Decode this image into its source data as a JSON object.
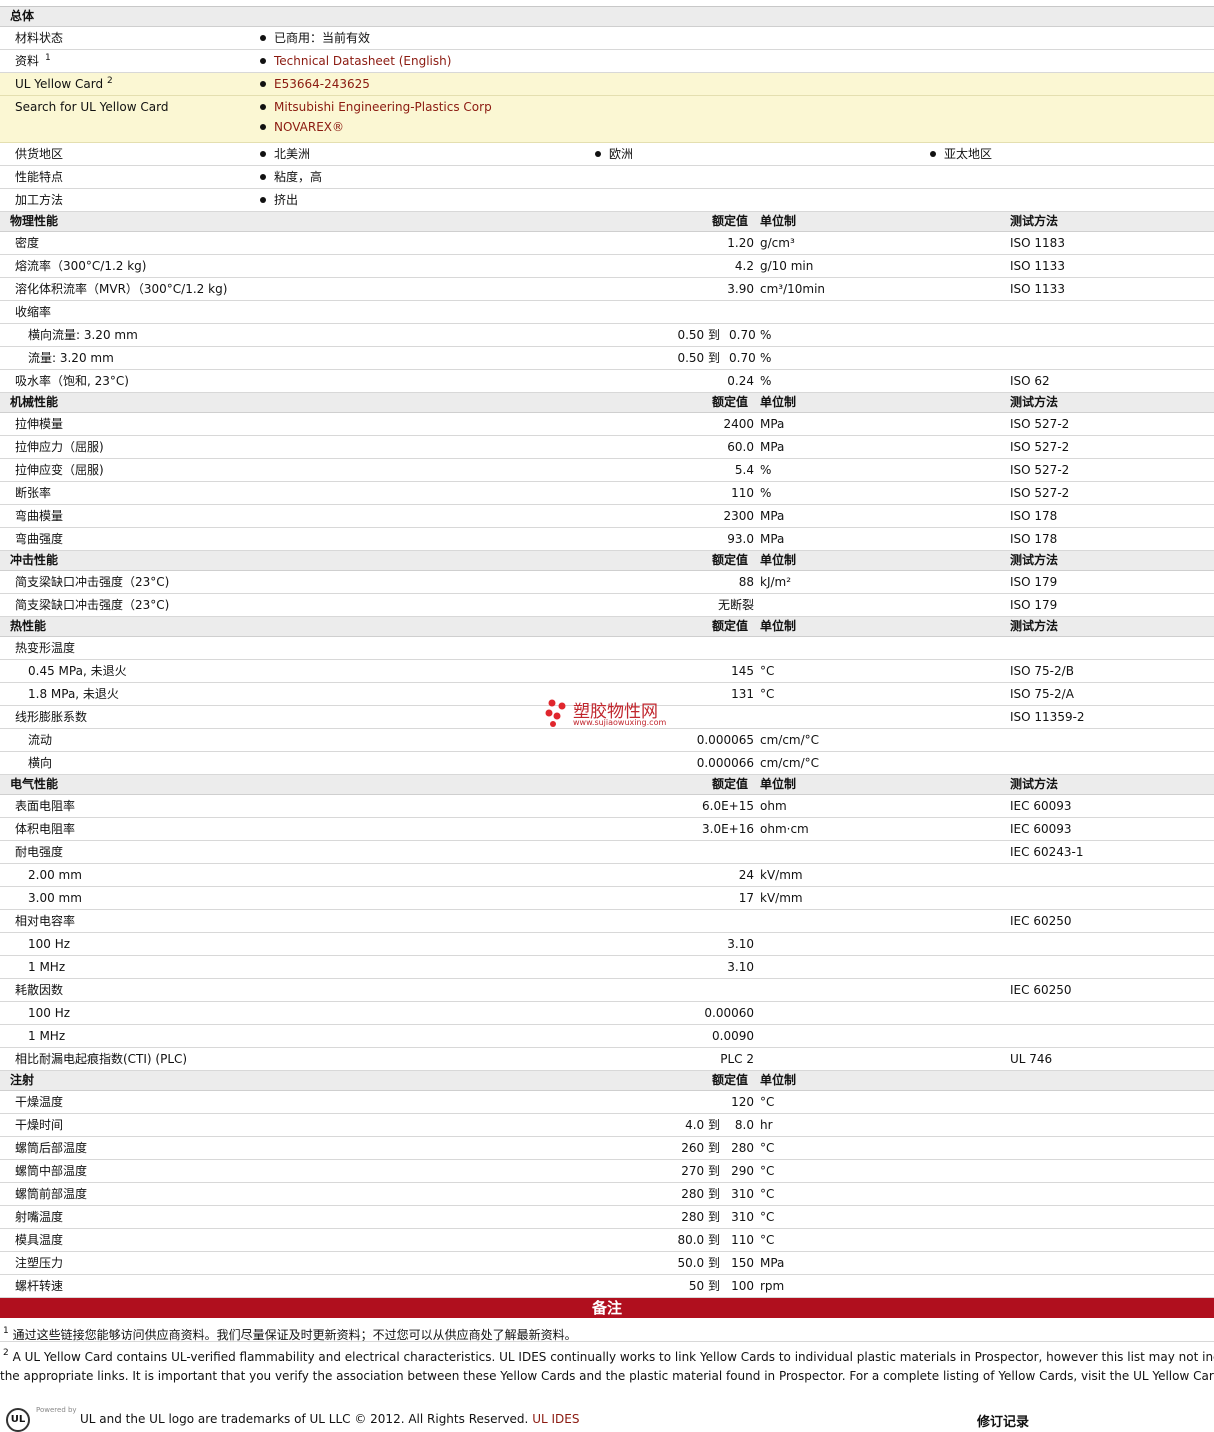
{
  "general": {
    "title": "总体",
    "rows": [
      {
        "label": "材料状态",
        "items": [
          "已商用：当前有效"
        ]
      },
      {
        "label": "资料",
        "sup": "1",
        "items": [
          "Technical Datasheet (English)"
        ],
        "link": true
      },
      {
        "label": "UL Yellow Card",
        "sup": "2",
        "items": [
          "E53664-243625"
        ],
        "link": true,
        "yellow": true
      },
      {
        "label": "Search for UL Yellow Card",
        "items": [
          "Mitsubishi Engineering-Plastics Corp",
          "NOVAREX®"
        ],
        "link": true,
        "yellow": true
      },
      {
        "label": "供货地区",
        "items": [
          "北美洲",
          "欧洲",
          "亚太地区"
        ],
        "spread": true
      },
      {
        "label": "性能特点",
        "items": [
          "粘度，高"
        ]
      },
      {
        "label": "加工方法",
        "items": [
          "挤出"
        ]
      }
    ]
  },
  "sections": [
    {
      "title": "物理性能",
      "h_value": "额定值",
      "h_unit": "单位制",
      "h_method": "测试方法",
      "rows": [
        {
          "label": "密度",
          "v1": "1.20",
          "unit": "g/cm³",
          "method": "ISO 1183"
        },
        {
          "label": "熔流率（300°C/1.2 kg)",
          "v1": "4.2",
          "unit": "g/10 min",
          "method": "ISO 1133"
        },
        {
          "label": "溶化体积流率（MVR）（300°C/1.2 kg)",
          "v1": "3.90",
          "unit": "cm³/10min",
          "method": "ISO 1133"
        },
        {
          "label": "收缩率"
        },
        {
          "label": "横向流量: 3.20 mm",
          "sub": true,
          "v1": "0.50 到",
          "v2": "0.70",
          "unit": "%"
        },
        {
          "label": "流量: 3.20 mm",
          "sub": true,
          "v1": "0.50 到",
          "v2": "0.70",
          "unit": "%"
        },
        {
          "label": "吸水率（饱和, 23°C)",
          "v1": "0.24",
          "unit": "%",
          "method": "ISO 62"
        }
      ]
    },
    {
      "title": "机械性能",
      "h_value": "额定值",
      "h_unit": "单位制",
      "h_method": "测试方法",
      "rows": [
        {
          "label": "拉伸模量",
          "v1": "2400",
          "unit": "MPa",
          "method": "ISO 527-2"
        },
        {
          "label": "拉伸应力（屈服)",
          "v1": "60.0",
          "unit": "MPa",
          "method": "ISO 527-2"
        },
        {
          "label": "拉伸应变（屈服)",
          "v1": "5.4",
          "unit": "%",
          "method": "ISO 527-2"
        },
        {
          "label": "断张率",
          "v1": "110",
          "unit": "%",
          "method": "ISO 527-2"
        },
        {
          "label": "弯曲模量",
          "v1": "2300",
          "unit": "MPa",
          "method": "ISO 178"
        },
        {
          "label": "弯曲强度",
          "v1": "93.0",
          "unit": "MPa",
          "method": "ISO 178"
        }
      ]
    },
    {
      "title": "冲击性能",
      "h_value": "额定值",
      "h_unit": "单位制",
      "h_method": "测试方法",
      "rows": [
        {
          "label": "简支梁缺口冲击强度（23°C)",
          "v1": "88",
          "unit": "kJ/m²",
          "method": "ISO 179"
        },
        {
          "label": "简支梁缺口冲击强度（23°C)",
          "v1": "无断裂",
          "method": "ISO 179"
        }
      ]
    },
    {
      "title": "热性能",
      "h_value": "额定值",
      "h_unit": "单位制",
      "h_method": "测试方法",
      "rows": [
        {
          "label": "热变形温度"
        },
        {
          "label": "0.45 MPa, 未退火",
          "sub": true,
          "v1": "145",
          "unit": "°C",
          "method": "ISO 75-2/B"
        },
        {
          "label": "1.8 MPa, 未退火",
          "sub": true,
          "v1": "131",
          "unit": "°C",
          "method": "ISO 75-2/A"
        },
        {
          "label": "线形膨胀系数",
          "method": "ISO 11359-2"
        },
        {
          "label": "流动",
          "sub": true,
          "v1": "0.000065",
          "unit": "cm/cm/°C"
        },
        {
          "label": "横向",
          "sub": true,
          "v1": "0.000066",
          "unit": "cm/cm/°C"
        }
      ]
    },
    {
      "title": "电气性能",
      "h_value": "额定值",
      "h_unit": "单位制",
      "h_method": "测试方法",
      "rows": [
        {
          "label": "表面电阻率",
          "v1": "6.0E+15",
          "unit": "ohm",
          "method": "IEC 60093"
        },
        {
          "label": "体积电阻率",
          "v1": "3.0E+16",
          "unit": "ohm·cm",
          "method": "IEC 60093"
        },
        {
          "label": "耐电强度",
          "method": "IEC 60243-1"
        },
        {
          "label": "2.00 mm",
          "sub": true,
          "v1": "24",
          "unit": "kV/mm"
        },
        {
          "label": "3.00 mm",
          "sub": true,
          "v1": "17",
          "unit": "kV/mm"
        },
        {
          "label": "相对电容率",
          "method": "IEC 60250"
        },
        {
          "label": "100 Hz",
          "sub": true,
          "v1": "3.10"
        },
        {
          "label": "1 MHz",
          "sub": true,
          "v1": "3.10"
        },
        {
          "label": "耗散因数",
          "method": "IEC 60250"
        },
        {
          "label": "100 Hz",
          "sub": true,
          "v1": "0.00060"
        },
        {
          "label": "1 MHz",
          "sub": true,
          "v1": "0.0090"
        },
        {
          "label": "相比耐漏电起痕指数(CTI) (PLC)",
          "v1": "PLC 2",
          "method": "UL 746"
        }
      ]
    },
    {
      "title": "注射",
      "h_value": "额定值",
      "h_unit": "单位制",
      "h_method": "",
      "rows": [
        {
          "label": "干燥温度",
          "v1": "120",
          "unit": "°C"
        },
        {
          "label": "干燥时间",
          "v1": "4.0 到",
          "v2": "8.0",
          "unit": "hr"
        },
        {
          "label": "螺筒后部温度",
          "v1": "260 到",
          "v2": "280",
          "unit": "°C"
        },
        {
          "label": "螺筒中部温度",
          "v1": "270 到",
          "v2": "290",
          "unit": "°C"
        },
        {
          "label": "螺筒前部温度",
          "v1": "280 到",
          "v2": "310",
          "unit": "°C"
        },
        {
          "label": "射嘴温度",
          "v1": "280 到",
          "v2": "310",
          "unit": "°C"
        },
        {
          "label": "模具温度",
          "v1": "80.0 到",
          "v2": "110",
          "unit": "°C"
        },
        {
          "label": "注塑压力",
          "v1": "50.0 到",
          "v2": "150",
          "unit": "MPa"
        },
        {
          "label": "螺杆转速",
          "v1": "50 到",
          "v2": "100",
          "unit": "rpm"
        }
      ]
    }
  ],
  "notes": {
    "title": "备注",
    "n1_sup": "1",
    "n1": "通过这些链接您能够访问供应商资料。我们尽量保证及时更新资料；不过您可以从供应商处了解最新资料。",
    "n2_sup": "2",
    "n2_line1": "A UL Yellow Card contains UL-verified flammability and electrical characteristics. UL IDES continually works to link Yellow Cards to individual plastic materials in Prospector, however this list may not include",
    "n2_line2": "the appropriate links. It is important that you verify the association between these Yellow Cards and the plastic material found in Prospector. For a complete listing of Yellow Cards, visit the UL Yellow Card Search"
  },
  "footer": {
    "powered": "Powered by",
    "text": "UL and the UL logo are trademarks of UL LLC © 2012. All Rights Reserved.",
    "link": "UL IDES",
    "revision": "修订记录"
  },
  "watermark": {
    "title": "塑胶物性网",
    "url": "www.sujiaowuxing.com"
  },
  "colors": {
    "band": "#b00f1e",
    "link": "#8b1a10",
    "yellow": "#fbf7d3"
  }
}
